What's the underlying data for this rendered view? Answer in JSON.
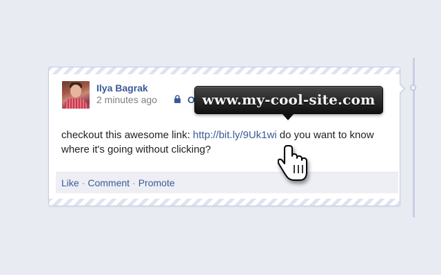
{
  "post": {
    "author_name": "Ilya Bagrak",
    "timestamp": "2 minutes ago",
    "privacy_label": "O",
    "text_before_link": "checkout this awesome link: ",
    "link_text": "http://bit.ly/9Uk1wi",
    "text_after_link": " do you want to know where it's going without clicking?"
  },
  "actions": {
    "like_label": "Like",
    "comment_label": "Comment",
    "promote_label": "Promote",
    "separator": "·"
  },
  "tooltip": {
    "url_text": "www.my-cool-site.com"
  },
  "icons": {
    "privacy": "lock-icon",
    "cursor": "hand-pointer-cursor-icon",
    "avatar": "profile-photo"
  },
  "colors": {
    "link_blue": "#3b5998",
    "background": "#e9ebf2",
    "tooltip_bg": "#222222"
  }
}
